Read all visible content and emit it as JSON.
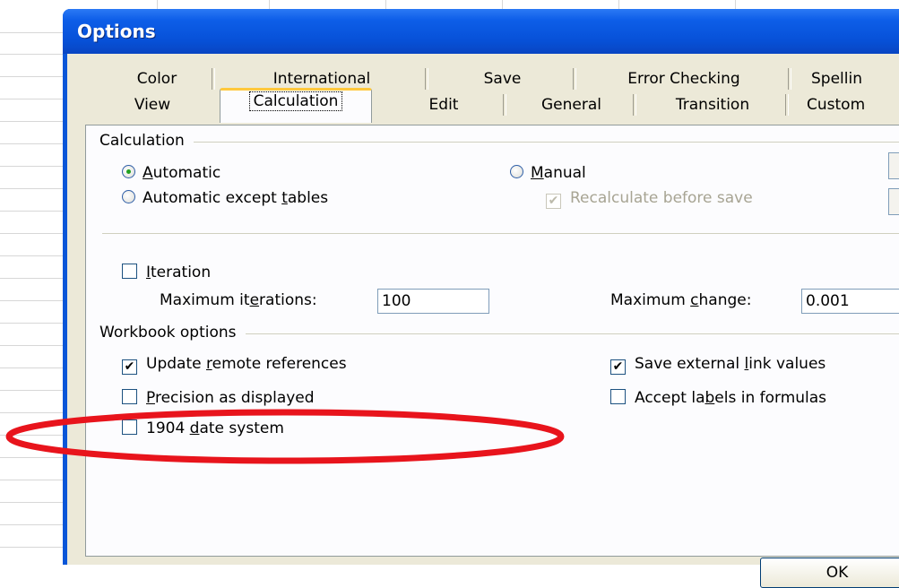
{
  "window": {
    "title": "Options"
  },
  "tabs_row1": [
    "Color",
    "International",
    "Save",
    "Error Checking",
    "Spellin"
  ],
  "tabs_row2": [
    "View",
    "Calculation",
    "Edit",
    "General",
    "Transition",
    "Custom"
  ],
  "active_tab": "Calculation",
  "calculation_group": {
    "title": "Calculation",
    "automatic": {
      "pre": "",
      "key": "A",
      "post": "utomatic",
      "selected": true
    },
    "automatic_except_tables": {
      "pre": "Automatic except ",
      "key": "t",
      "post": "ables",
      "selected": false
    },
    "manual": {
      "pre": "",
      "key": "M",
      "post": "anual",
      "selected": false
    },
    "recalculate_before_save": {
      "label": "Recalculate before save",
      "checked": true,
      "enabled": false
    }
  },
  "iteration": {
    "check": {
      "pre": "",
      "key": "I",
      "post": "teration",
      "checked": false
    },
    "max_iterations": {
      "pre": "Maximum it",
      "key": "e",
      "post": "rations:",
      "value": "100"
    },
    "max_change": {
      "pre": "Maximum ",
      "key": "c",
      "post": "hange:",
      "value": "0.001"
    }
  },
  "workbook_group": {
    "title": "Workbook options",
    "update_remote": {
      "pre": "Update ",
      "key": "r",
      "post": "emote references",
      "checked": true
    },
    "precision": {
      "pre": "",
      "key": "P",
      "post": "recision as displayed",
      "checked": false
    },
    "date_1904": {
      "pre": "1904 ",
      "key": "d",
      "post": "ate system",
      "checked": false
    },
    "save_external": {
      "pre": "Save external ",
      "key": "l",
      "post": "ink values",
      "checked": true
    },
    "accept_labels": {
      "pre": "Accept la",
      "key": "b",
      "post": "els in formulas",
      "checked": false
    }
  },
  "buttons": {
    "ok": "OK"
  },
  "colors": {
    "title_bar": "#0751d8",
    "dialog_bg": "#ece9d8",
    "highlight": "#e8141c",
    "tab_accent": "#ffc83c"
  }
}
